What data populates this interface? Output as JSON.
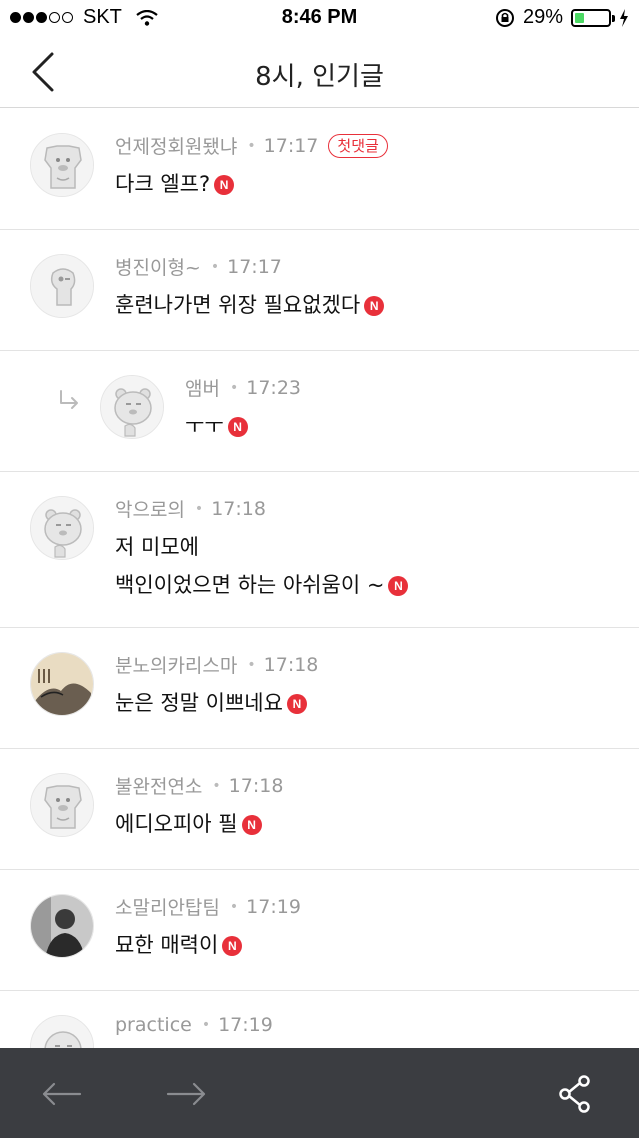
{
  "status_bar": {
    "carrier": "SKT",
    "time": "8:46 PM",
    "battery": "29%",
    "battery_level": 0.29,
    "signal_filled": 3,
    "signal_total": 5
  },
  "nav": {
    "title": "8시, 인기글"
  },
  "comments": [
    {
      "author": "언제정회원됐냐",
      "time": "17:17",
      "first_badge": "첫댓글",
      "lines": [
        "다크 엘프?"
      ],
      "new": "N",
      "avatar_icon": "dog-character-icon"
    },
    {
      "author": "병진이형~",
      "time": "17:17",
      "lines": [
        "훈련나가면 위장 필요없겠다"
      ],
      "new": "N",
      "avatar_icon": "cat-character-icon"
    },
    {
      "author": "앰버",
      "time": "17:23",
      "lines": [
        "ㅜㅜ"
      ],
      "new": "N",
      "avatar_icon": "lion-character-icon",
      "reply": true
    },
    {
      "author": "악으로의",
      "time": "17:18",
      "lines": [
        "저 미모에",
        "백인이었으면 하는 아쉬움이 ~"
      ],
      "new": "N",
      "avatar_icon": "lion-character-icon"
    },
    {
      "author": "분노의카리스마",
      "time": "17:18",
      "lines": [
        "눈은 정말 이쁘네요"
      ],
      "new": "N",
      "avatar_icon": "ink-painting-avatar"
    },
    {
      "author": "불완전연소",
      "time": "17:18",
      "lines": [
        "에디오피아 필"
      ],
      "new": "N",
      "avatar_icon": "dog-character-icon"
    },
    {
      "author": "소말리안탑팀",
      "time": "17:19",
      "lines": [
        "묘한 매력이"
      ],
      "new": "N",
      "avatar_icon": "photo-avatar"
    },
    {
      "author": "practice",
      "time": "17:19",
      "lines": [],
      "avatar_icon": "character-avatar"
    }
  ],
  "colors": {
    "accent": "#e8303a",
    "toolbar": "#3b3d41",
    "meta": "#999999"
  },
  "toolbar": {
    "icons": [
      "back-arrow-icon",
      "forward-arrow-icon",
      "share-icon"
    ]
  }
}
